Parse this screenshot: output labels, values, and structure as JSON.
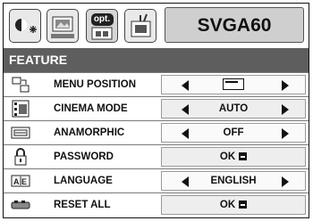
{
  "menu": {
    "title": "SVGA60",
    "section": "FEATURE",
    "tabs": [
      {
        "name": "image-adjust-tab",
        "icon": "image-adjust-icon"
      },
      {
        "name": "picture-tab",
        "icon": "picture-icon"
      },
      {
        "name": "option-tab",
        "icon": "option-icon",
        "label": "opt.",
        "active": true
      },
      {
        "name": "setting-tab",
        "icon": "setting-icon"
      }
    ],
    "rows": [
      {
        "label": "MENU POSITION",
        "value": "",
        "icon": "menu-position-icon",
        "arrows": true,
        "value_icon": "position-indicator-icon"
      },
      {
        "label": "CINEMA MODE",
        "value": "AUTO",
        "icon": "cinema-mode-icon",
        "arrows": true
      },
      {
        "label": "ANAMORPHIC",
        "value": "OFF",
        "icon": "anamorphic-icon",
        "arrows": true
      },
      {
        "label": "PASSWORD",
        "value": "OK",
        "icon": "lock-icon",
        "arrows": false,
        "enter": true
      },
      {
        "label": "LANGUAGE",
        "value": "ENGLISH",
        "icon": "language-icon",
        "arrows": true
      },
      {
        "label": "RESET ALL",
        "value": "OK",
        "icon": "reset-icon",
        "arrows": false,
        "enter": true
      }
    ]
  }
}
